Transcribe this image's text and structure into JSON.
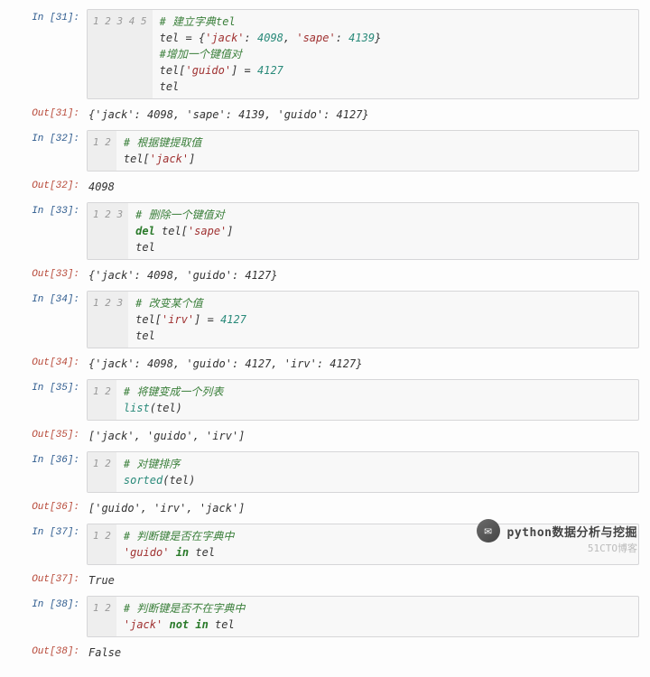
{
  "cells": [
    {
      "in_label": "In [31]:",
      "gutter": [
        "1",
        "2",
        "3",
        "4",
        "5"
      ],
      "lines": [
        [
          {
            "t": "# 建立字典tel",
            "c": "c-comment"
          }
        ],
        [
          {
            "t": "tel = {"
          },
          {
            "t": "'jack'",
            "c": "c-string"
          },
          {
            "t": ": "
          },
          {
            "t": "4098",
            "c": "c-number"
          },
          {
            "t": ", "
          },
          {
            "t": "'sape'",
            "c": "c-string"
          },
          {
            "t": ": "
          },
          {
            "t": "4139",
            "c": "c-number"
          },
          {
            "t": "}"
          }
        ],
        [
          {
            "t": "#增加一个键值对",
            "c": "c-comment"
          }
        ],
        [
          {
            "t": "tel["
          },
          {
            "t": "'guido'",
            "c": "c-string"
          },
          {
            "t": "] = "
          },
          {
            "t": "4127",
            "c": "c-number"
          }
        ],
        [
          {
            "t": "tel"
          }
        ]
      ],
      "out_label": "Out[31]:",
      "output": "{'jack': 4098, 'sape': 4139, 'guido': 4127}"
    },
    {
      "in_label": "In [32]:",
      "gutter": [
        "1",
        "2"
      ],
      "lines": [
        [
          {
            "t": "# 根据键提取值",
            "c": "c-comment"
          }
        ],
        [
          {
            "t": "tel["
          },
          {
            "t": "'jack'",
            "c": "c-string"
          },
          {
            "t": "]"
          }
        ]
      ],
      "out_label": "Out[32]:",
      "output": "4098"
    },
    {
      "in_label": "In [33]:",
      "gutter": [
        "1",
        "2",
        "3"
      ],
      "lines": [
        [
          {
            "t": "# 删除一个键值对",
            "c": "c-comment"
          }
        ],
        [
          {
            "t": "del ",
            "c": "c-keyword"
          },
          {
            "t": "tel["
          },
          {
            "t": "'sape'",
            "c": "c-string"
          },
          {
            "t": "]"
          }
        ],
        [
          {
            "t": "tel"
          }
        ]
      ],
      "out_label": "Out[33]:",
      "output": "{'jack': 4098, 'guido': 4127}"
    },
    {
      "in_label": "In [34]:",
      "gutter": [
        "1",
        "2",
        "3"
      ],
      "lines": [
        [
          {
            "t": "# 改变某个值",
            "c": "c-comment"
          }
        ],
        [
          {
            "t": "tel["
          },
          {
            "t": "'irv'",
            "c": "c-string"
          },
          {
            "t": "] = "
          },
          {
            "t": "4127",
            "c": "c-number"
          }
        ],
        [
          {
            "t": "tel"
          }
        ]
      ],
      "out_label": "Out[34]:",
      "output": "{'jack': 4098, 'guido': 4127, 'irv': 4127}"
    },
    {
      "in_label": "In [35]:",
      "gutter": [
        "1",
        "2"
      ],
      "lines": [
        [
          {
            "t": "# 将键变成一个列表",
            "c": "c-comment"
          }
        ],
        [
          {
            "t": "list",
            "c": "c-builtin"
          },
          {
            "t": "(tel)"
          }
        ]
      ],
      "out_label": "Out[35]:",
      "output": "['jack', 'guido', 'irv']"
    },
    {
      "in_label": "In [36]:",
      "gutter": [
        "1",
        "2"
      ],
      "lines": [
        [
          {
            "t": "# 对键排序",
            "c": "c-comment"
          }
        ],
        [
          {
            "t": "sorted",
            "c": "c-builtin"
          },
          {
            "t": "(tel)"
          }
        ]
      ],
      "out_label": "Out[36]:",
      "output": "['guido', 'irv', 'jack']"
    },
    {
      "in_label": "In [37]:",
      "gutter": [
        "1",
        "2"
      ],
      "lines": [
        [
          {
            "t": "# 判断键是否在字典中",
            "c": "c-comment"
          }
        ],
        [
          {
            "t": "'guido'",
            "c": "c-string"
          },
          {
            "t": " "
          },
          {
            "t": "in",
            "c": "c-keyword"
          },
          {
            "t": " tel"
          }
        ]
      ],
      "out_label": "Out[37]:",
      "output": "True"
    },
    {
      "in_label": "In [38]:",
      "gutter": [
        "1",
        "2"
      ],
      "lines": [
        [
          {
            "t": "# 判断键是否不在字典中",
            "c": "c-comment"
          }
        ],
        [
          {
            "t": "'jack'",
            "c": "c-string"
          },
          {
            "t": " "
          },
          {
            "t": "not in",
            "c": "c-keyword"
          },
          {
            "t": " tel"
          }
        ]
      ],
      "out_label": "Out[38]:",
      "output": "False"
    }
  ],
  "watermark": {
    "icon_glyph": "✉",
    "text": "python数据分析与挖掘",
    "sub": "51CTO博客"
  }
}
